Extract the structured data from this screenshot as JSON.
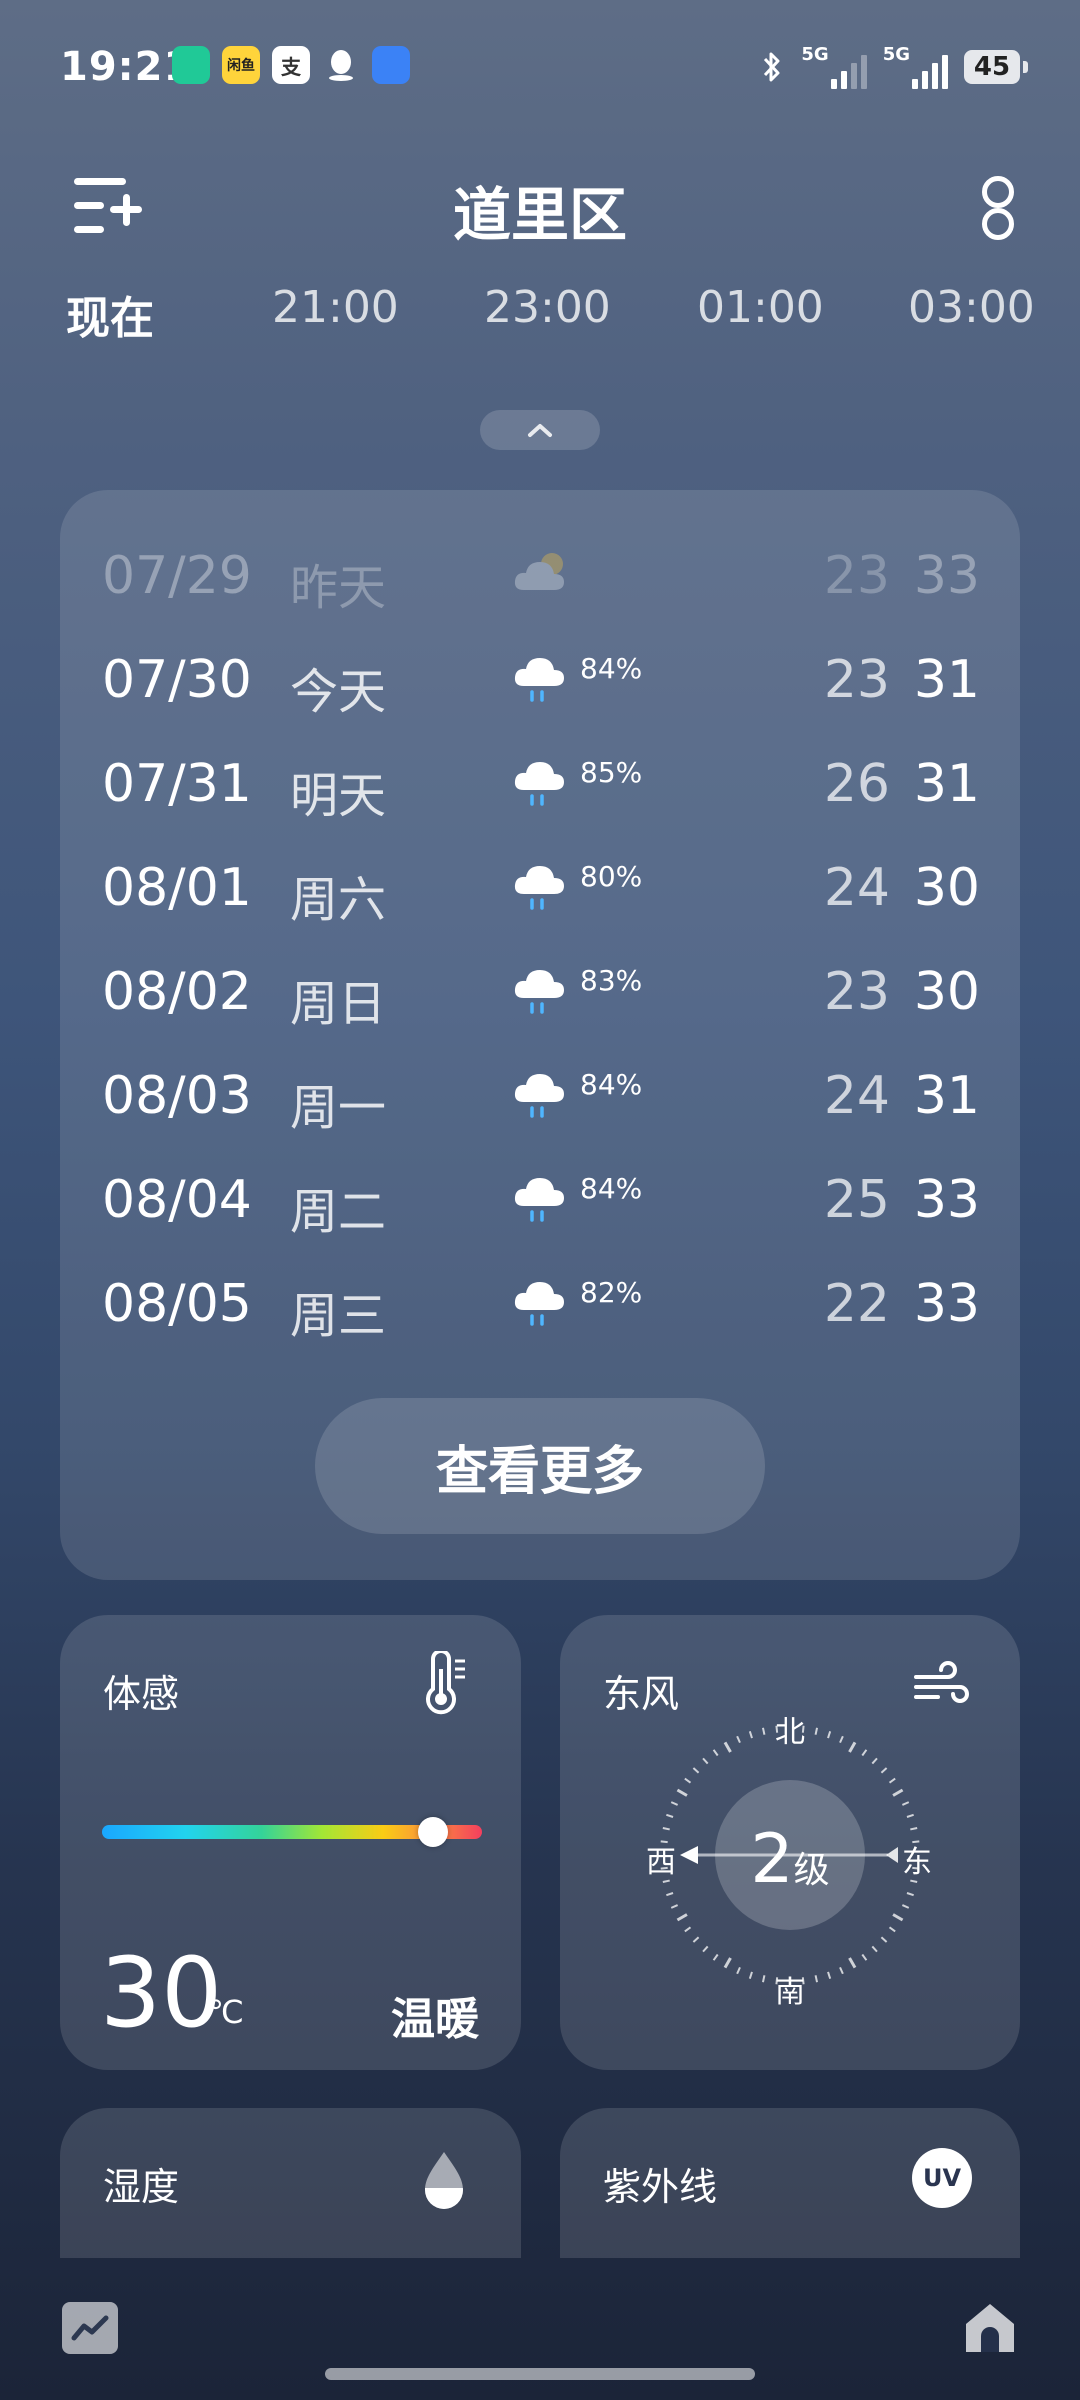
{
  "status_bar": {
    "time": "19:21",
    "apps": [
      {
        "icon": "green-app-icon",
        "label": ""
      },
      {
        "icon": "yellow-app-icon",
        "label": "闲鱼"
      },
      {
        "icon": "alipay-icon",
        "label": "支"
      },
      {
        "icon": "qq-icon",
        "label": ""
      },
      {
        "icon": "blue-app-icon",
        "label": ""
      }
    ],
    "network1": "5G",
    "network2": "5G",
    "battery": "45"
  },
  "header": {
    "city": "道里区"
  },
  "hourly": {
    "items": [
      "现在",
      "21:00",
      "23:00",
      "01:00",
      "03:00"
    ]
  },
  "forecast": {
    "rows": [
      {
        "date": "07/29",
        "day": "昨天",
        "icon": "cloudy-sun-icon",
        "prob": "",
        "low": "23",
        "high": "33",
        "past": true
      },
      {
        "date": "07/30",
        "day": "今天",
        "icon": "rain-icon",
        "prob": "84%",
        "low": "23",
        "high": "31"
      },
      {
        "date": "07/31",
        "day": "明天",
        "icon": "rain-icon",
        "prob": "85%",
        "low": "26",
        "high": "31"
      },
      {
        "date": "08/01",
        "day": "周六",
        "icon": "rain-icon",
        "prob": "80%",
        "low": "24",
        "high": "30"
      },
      {
        "date": "08/02",
        "day": "周日",
        "icon": "rain-icon",
        "prob": "83%",
        "low": "23",
        "high": "30"
      },
      {
        "date": "08/03",
        "day": "周一",
        "icon": "rain-icon",
        "prob": "84%",
        "low": "24",
        "high": "31"
      },
      {
        "date": "08/04",
        "day": "周二",
        "icon": "rain-icon",
        "prob": "84%",
        "low": "25",
        "high": "33"
      },
      {
        "date": "08/05",
        "day": "周三",
        "icon": "rain-icon",
        "prob": "82%",
        "low": "22",
        "high": "33"
      }
    ],
    "see_more": "查看更多"
  },
  "feels_like": {
    "title": "体感",
    "value": "30",
    "unit": "℃",
    "description": "温暖",
    "scale_fraction": 0.87
  },
  "wind": {
    "title": "东风",
    "level": "2",
    "level_unit": "级",
    "north": "北",
    "south": "南",
    "west": "西",
    "east": "东"
  },
  "humidity": {
    "title": "湿度"
  },
  "uv": {
    "title": "紫外线",
    "badge": "UV"
  }
}
